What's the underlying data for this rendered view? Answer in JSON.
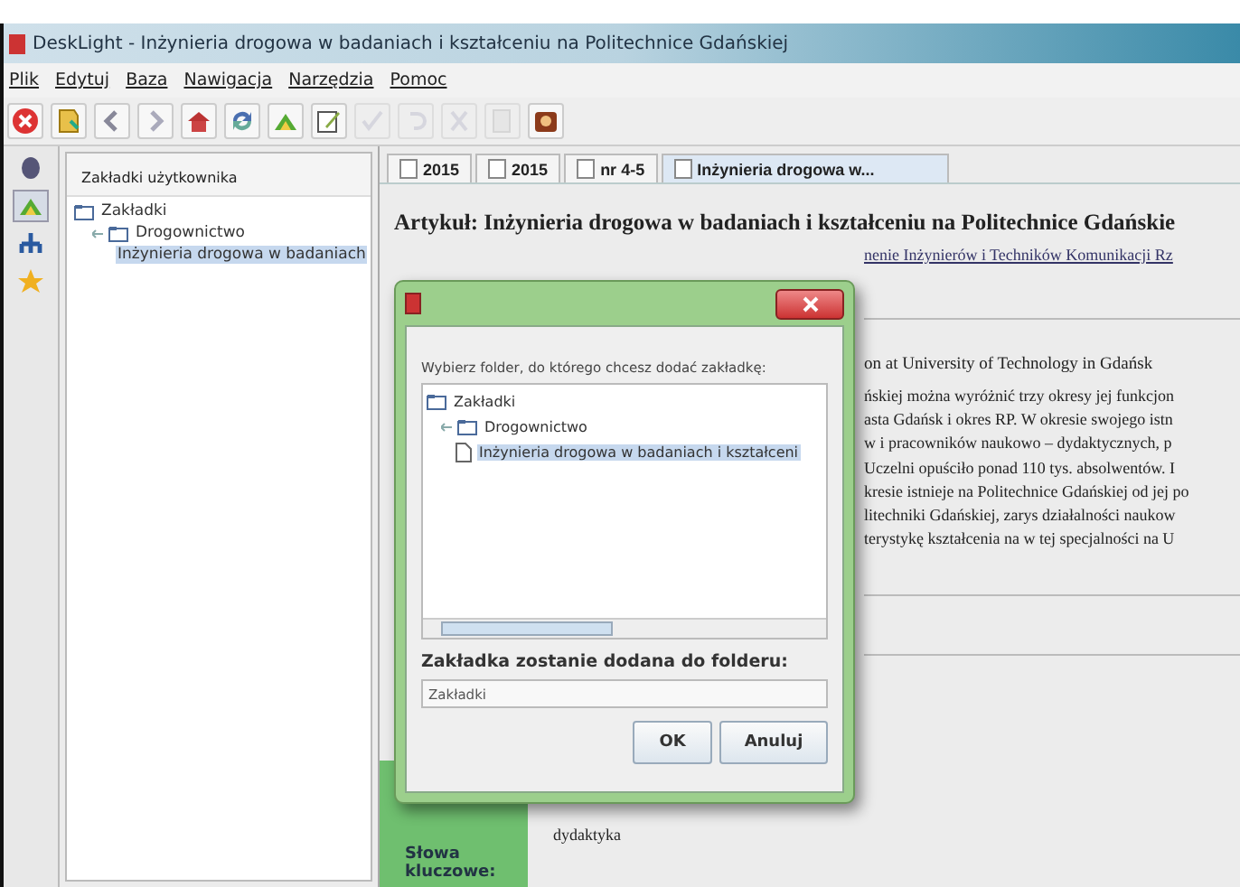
{
  "window": {
    "title": "DeskLight - Inżynieria drogowa w badaniach i kształceniu na Politechnice Gdańskiej"
  },
  "menu": [
    "Plik",
    "Edytuj",
    "Baza",
    "Nawigacja",
    "Narzędzia",
    "Pomoc"
  ],
  "toolbar": [
    {
      "kind": "close",
      "disabled": false
    },
    {
      "kind": "bookmark",
      "disabled": false
    },
    {
      "kind": "back",
      "disabled": false
    },
    {
      "kind": "forward",
      "disabled": false
    },
    {
      "kind": "home",
      "disabled": false
    },
    {
      "kind": "refresh",
      "disabled": false
    },
    {
      "kind": "hand",
      "disabled": false
    },
    {
      "kind": "edit",
      "disabled": false
    },
    {
      "kind": "check",
      "disabled": true
    },
    {
      "kind": "undo",
      "disabled": true
    },
    {
      "kind": "cut",
      "disabled": true
    },
    {
      "kind": "paste",
      "disabled": true
    },
    {
      "kind": "box",
      "disabled": false
    }
  ],
  "side_strip": [
    {
      "kind": "database",
      "selected": false
    },
    {
      "kind": "bookmarks",
      "selected": true
    },
    {
      "kind": "tree",
      "selected": false
    },
    {
      "kind": "star",
      "selected": false
    }
  ],
  "bookmarks_panel": {
    "title": "Zakładki użytkownika",
    "tree": [
      {
        "label": "Zakładki",
        "kind": "folder",
        "selected": false,
        "children": [
          {
            "label": "Drogownictwo",
            "kind": "folder",
            "selected": false,
            "children": [
              {
                "label": "Inżynieria drogowa w badaniach",
                "kind": "document",
                "selected": true
              }
            ]
          }
        ]
      }
    ]
  },
  "tabs": [
    {
      "label": "2015",
      "selected": false
    },
    {
      "label": "2015",
      "selected": false
    },
    {
      "label": "nr 4-5",
      "selected": false
    },
    {
      "label": "Inżynieria drogowa w...",
      "selected": true
    }
  ],
  "article": {
    "title": "Artykuł: Inżynieria drogowa w badaniach i kształceniu na Politechnice Gdańskie",
    "link": "nenie Inżynierów i Techników Komunikacji Rz",
    "english_title": "on at University of Technology in Gdańsk",
    "abstract_lines": [
      "ńskiej można wyróżnić trzy okresy jej funkcjon",
      "asta Gdańsk i okres RP. W okresie swojego istn",
      "w i pracowników naukowo – dydaktycznych, p",
      "Uczelni opuściło ponad 110 tys. absolwentów. I",
      "kresie istnieje na Politechnice Gdańskiej od jej po",
      "litechniki Gdańskiej, zarys działalności naukow",
      "terystykę kształcenia na w tej specjalności na U"
    ],
    "keywords_label": "Słowa kluczowe:",
    "keywords": "dydaktyka"
  },
  "dialog": {
    "prompt": "Wybierz folder, do którego chcesz dodać zakładkę:",
    "tree": [
      {
        "label": "Zakładki",
        "kind": "folder",
        "selected": false,
        "children": [
          {
            "label": "Drogownictwo",
            "kind": "folder",
            "selected": false,
            "children": [
              {
                "label": "Inżynieria drogowa w badaniach i kształceni",
                "kind": "document",
                "selected": true
              }
            ]
          }
        ]
      }
    ],
    "target_label": "Zakładka zostanie dodana do folderu:",
    "target_value": "Zakładki",
    "buttons": [
      "OK",
      "Anuluj"
    ]
  }
}
